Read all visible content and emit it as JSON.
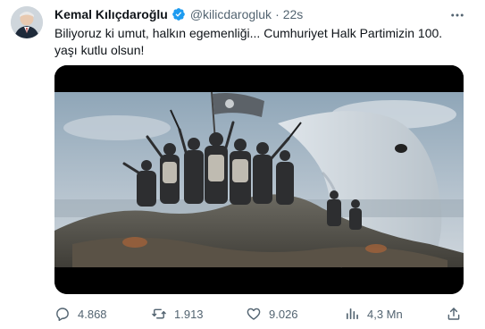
{
  "author": {
    "name": "Kemal Kılıçdaroğlu",
    "handle": "@kilicdarogluk",
    "separator": "·",
    "time": "22s",
    "verified": true
  },
  "tweet": {
    "text": "Biliyoruz ki umut, halkın egemenliği... Cumhuriyet Halk Partimizin 100. yaşı kutlu olsun!"
  },
  "actions": {
    "replies": "4.868",
    "reposts": "1.913",
    "likes": "9.026",
    "views": "4,3 Mn"
  },
  "colors": {
    "verified": "#1d9bf0",
    "secondary_text": "#536471",
    "primary_text": "#0f1419",
    "media_bg": "#000000"
  },
  "icons": {
    "more": "more-icon",
    "reply": "reply-icon",
    "repost": "repost-icon",
    "like": "like-icon",
    "views": "views-icon",
    "share": "share-icon",
    "verified": "verified-badge-icon"
  }
}
